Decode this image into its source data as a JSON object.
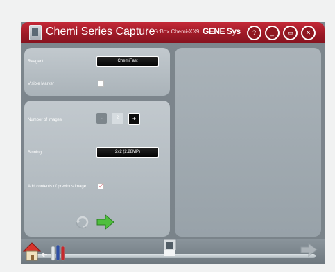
{
  "window": {
    "title": "Chemi Series Capture",
    "model": "G:Box Chemi-XX9",
    "brand": "GENE Sys"
  },
  "title_buttons": {
    "help": "?",
    "minimize": "_",
    "maximize": "▭",
    "close": "✕"
  },
  "reagent": {
    "label": "Reagent",
    "value": "ChemiFast"
  },
  "visible_marker": {
    "label": "Visible Marker",
    "checked": false
  },
  "images": {
    "label": "Number of images",
    "minus": "-",
    "value": "2",
    "plus": "+"
  },
  "binning": {
    "label": "Binning",
    "value": "2x2 (2.28MP)"
  },
  "add_previous": {
    "label": "Add contents of previous image",
    "checked": true,
    "check_glyph": "✓"
  },
  "colors": {
    "titlebar": "#9e1a27",
    "panel": "#b2bbc1",
    "window_bg": "#7d868d",
    "go_arrow": "#49b24a"
  }
}
